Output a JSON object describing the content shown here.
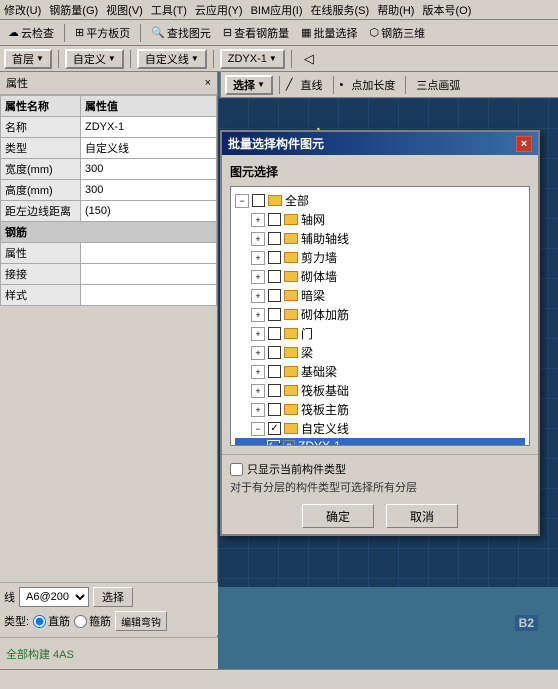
{
  "menubar": {
    "items": [
      "修改(U)",
      "钢筋量(G)",
      "视图(V)",
      "工具(T)",
      "云应用(Y)",
      "BIM应用(I)",
      "在线服务(S)",
      "帮助(H)",
      "版本号(O)"
    ]
  },
  "toolbar1": {
    "items": [
      "云检查",
      "平方板页",
      "查找图元",
      "查看钢筋量",
      "批量选择",
      "钢筋三维"
    ]
  },
  "toolbar2": {
    "floor": "首层",
    "axis1": "自定义",
    "axis2": "自定义线",
    "element": "ZDYX-1",
    "select_label": "选择"
  },
  "toolbar3": {
    "line_label": "直线",
    "point_label": "点加长度",
    "arc_label": "三点画弧"
  },
  "left_panel": {
    "title": "属性",
    "properties": [
      {
        "label": "属性名称",
        "value": "属性值",
        "is_header": true
      },
      {
        "label": "名称",
        "value": "ZDYX-1"
      },
      {
        "label": "类型",
        "value": "自定义线"
      },
      {
        "label": "宽度(mm)",
        "value": "300"
      },
      {
        "label": "高度(mm)",
        "value": "300"
      },
      {
        "label": "距左边线距离",
        "value": "(150)"
      },
      {
        "label": "钢筋",
        "value": "",
        "is_section": true
      },
      {
        "label": "属性",
        "value": ""
      },
      {
        "label": "接接",
        "value": ""
      },
      {
        "label": "样式",
        "value": ""
      }
    ]
  },
  "bottom_toolbar": {
    "line_type_label": "线",
    "steel_select": "A6@200",
    "select_btn": "选择",
    "type_label": "类型:",
    "straight": "直筋",
    "bent": "箍筋",
    "edit": "编辑弯钩"
  },
  "dialog": {
    "title": "批量选择构件图元",
    "close_btn": "×",
    "section_label": "图元选择",
    "tree": {
      "items": [
        {
          "label": "全部",
          "level": 1,
          "expanded": true,
          "checked": false,
          "type": "folder"
        },
        {
          "label": "轴网",
          "level": 2,
          "expanded": true,
          "checked": false,
          "type": "folder"
        },
        {
          "label": "辅助轴线",
          "level": 2,
          "expanded": true,
          "checked": false,
          "type": "folder"
        },
        {
          "label": "剪力墙",
          "level": 2,
          "expanded": true,
          "checked": false,
          "type": "folder"
        },
        {
          "label": "砌体墙",
          "level": 2,
          "expanded": true,
          "checked": false,
          "type": "folder"
        },
        {
          "label": "暗梁",
          "level": 2,
          "expanded": true,
          "checked": false,
          "type": "folder"
        },
        {
          "label": "砌体加筋",
          "level": 2,
          "expanded": true,
          "checked": false,
          "type": "folder"
        },
        {
          "label": "门",
          "level": 2,
          "expanded": true,
          "checked": false,
          "type": "folder"
        },
        {
          "label": "梁",
          "level": 2,
          "expanded": true,
          "checked": false,
          "type": "folder"
        },
        {
          "label": "基础梁",
          "level": 2,
          "expanded": true,
          "checked": false,
          "type": "folder"
        },
        {
          "label": "筏板基础",
          "level": 2,
          "expanded": true,
          "checked": false,
          "type": "folder"
        },
        {
          "label": "筏板主筋",
          "level": 2,
          "expanded": true,
          "checked": false,
          "type": "folder"
        },
        {
          "label": "自定义线",
          "level": 2,
          "expanded": true,
          "checked": true,
          "type": "folder"
        },
        {
          "label": "ZDYX-1",
          "level": 3,
          "expanded": false,
          "checked": true,
          "type": "item",
          "selected": true
        }
      ]
    },
    "show_current_only_label": "只显示当前构件类型",
    "hint_text": "对于有分层的构件类型可选择所有分层",
    "ok_btn": "确定",
    "cancel_btn": "取消"
  },
  "status": {
    "coords": "B2",
    "selection_count": "全部构建 4AS"
  }
}
